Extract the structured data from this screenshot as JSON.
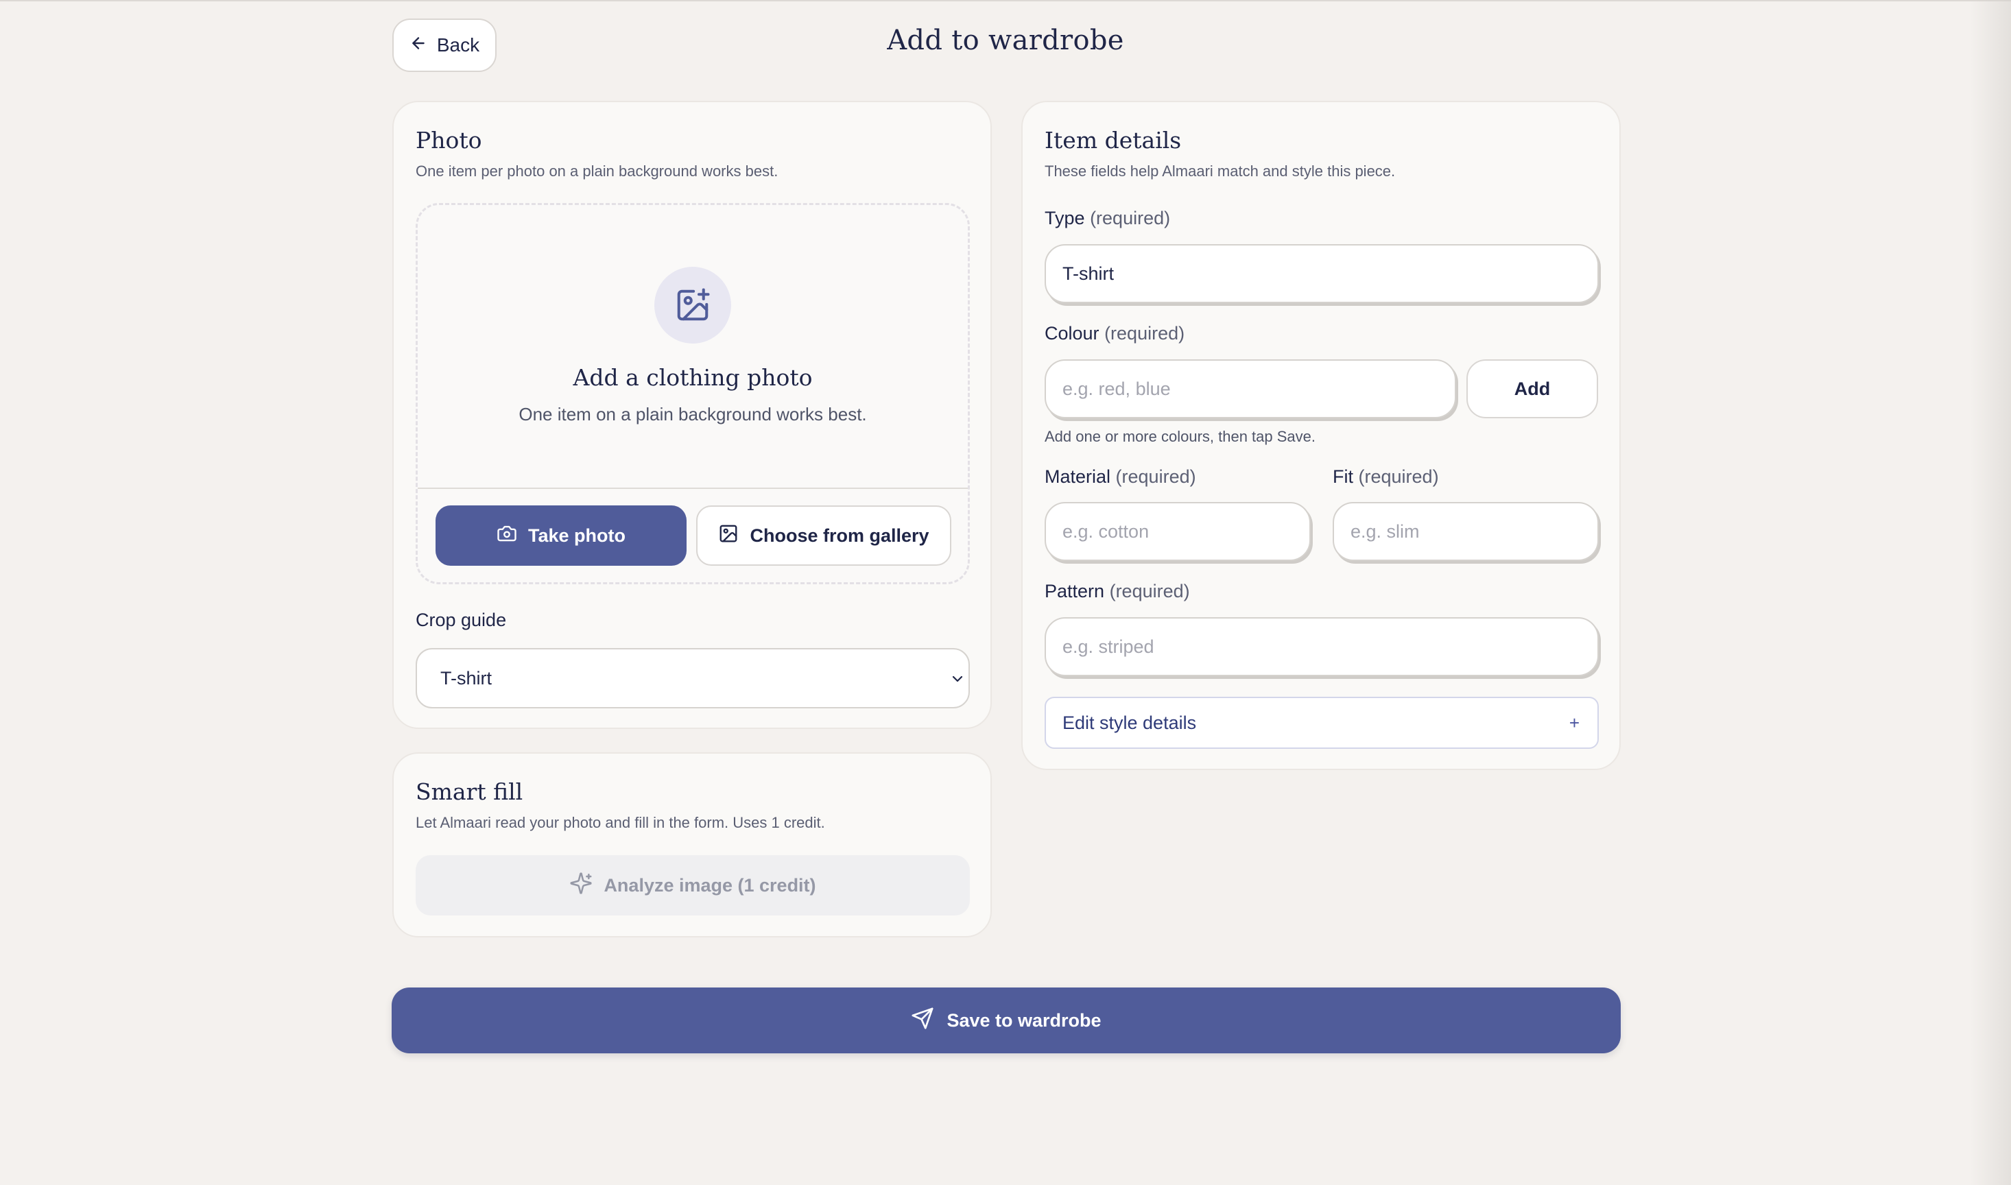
{
  "header": {
    "back_label": "Back",
    "title": "Add to wardrobe"
  },
  "photo": {
    "title": "Photo",
    "subtitle": "One item per photo on a plain background works best.",
    "dropzone_title": "Add a clothing photo",
    "dropzone_subtitle": "One item on a plain background works best.",
    "take_photo_label": "Take photo",
    "gallery_label": "Choose from gallery",
    "crop_label": "Crop guide",
    "crop_value": "T-shirt"
  },
  "smart_fill": {
    "title": "Smart fill",
    "subtitle": "Let Almaari read your photo and fill in the form. Uses 1 credit.",
    "analyze_label": "Analyze image (1 credit)"
  },
  "details": {
    "title": "Item details",
    "subtitle": "These fields help Almaari match and style this piece.",
    "required_suffix": "(required)",
    "type_label": "Type",
    "type_value": "T-shirt",
    "colour_label": "Colour",
    "colour_placeholder": "e.g. red, blue",
    "add_label": "Add",
    "colour_hint": "Add one or more colours, then tap Save.",
    "material_label": "Material",
    "material_placeholder": "e.g. cotton",
    "fit_label": "Fit",
    "fit_placeholder": "e.g. slim",
    "pattern_label": "Pattern",
    "pattern_placeholder": "e.g. striped",
    "style_details_label": "Edit style details",
    "style_details_toggle": "+"
  },
  "footer": {
    "save_label": "Save to wardrobe"
  },
  "icons": {
    "back": "arrow-left-icon",
    "add_photo": "image-plus-icon",
    "camera": "camera-icon",
    "gallery": "image-icon",
    "chevron": "chevron-down-icon",
    "sparkles": "sparkles-icon",
    "send": "send-icon"
  },
  "colors": {
    "primary": "#505c9a",
    "background": "#f4f1ee",
    "card": "#faf9f7",
    "text": "#1f2547"
  }
}
